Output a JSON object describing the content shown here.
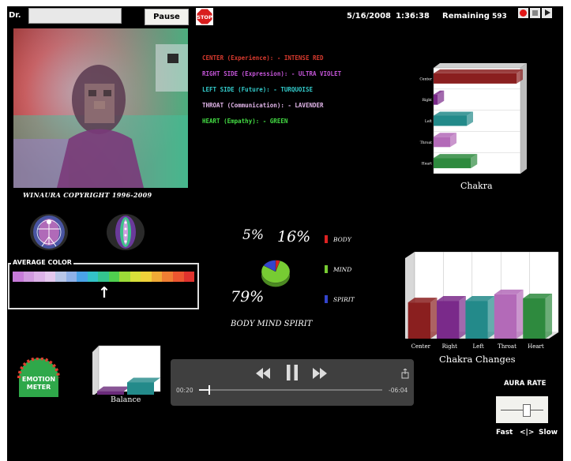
{
  "header": {
    "dr_label": "Dr.",
    "pause_label": "Pause",
    "stop_label": "STOP",
    "date": "5/16/2008",
    "time": "1:36:38",
    "remaining_label": "Remaining",
    "remaining_value": "593"
  },
  "video": {
    "copyright": "WINAURA  COPYRIGHT 1996-2009"
  },
  "chakra_list": [
    {
      "text": "CENTER (Experience):  - INTENSE RED",
      "color": "#d83a2e"
    },
    {
      "text": "RIGHT SIDE (Expression): - ULTRA VIOLET",
      "color": "#c455d8"
    },
    {
      "text": "LEFT SIDE (Future):  - TURQUOISE",
      "color": "#33cccc"
    },
    {
      "text": "THROAT (Communication):  - LAVENDER",
      "color": "#e2b6ea"
    },
    {
      "text": "HEART (Empathy): - GREEN",
      "color": "#44dd44"
    }
  ],
  "average_color": {
    "label": "AVERAGE COLOR",
    "swatches": [
      "#c77bd9",
      "#d19ae0",
      "#dcb2e8",
      "#e4c8ee",
      "#b8c6e8",
      "#8fb1e8",
      "#4aa3e8",
      "#33c2c8",
      "#33c48f",
      "#4fd04f",
      "#9ddc38",
      "#d8e03a",
      "#f0d23a",
      "#f0aa36",
      "#ef7e33",
      "#ec5630",
      "#e0332e"
    ],
    "arrow": "↑"
  },
  "chakra_chart": {
    "title": "Chakra",
    "categories": [
      "Center",
      "Right",
      "Left",
      "Throat",
      "Heart"
    ],
    "values": [
      100,
      5,
      40,
      20,
      45
    ],
    "colors": [
      "#8a1f1f",
      "#7a2a8a",
      "#238a8a",
      "#b36ab8",
      "#2e8a3e"
    ]
  },
  "pie": {
    "title": "BODY MIND SPIRIT",
    "labels": [
      "BODY",
      "MIND",
      "SPIRIT"
    ],
    "values": [
      5,
      79,
      16
    ],
    "pct_labels": [
      "5%",
      "79%",
      "16%"
    ],
    "colors": [
      "#dd2222",
      "#77cc33",
      "#3344cc"
    ]
  },
  "chakra_changes": {
    "title": "Chakra Changes",
    "categories": [
      "Center",
      "Right",
      "Left",
      "Throat",
      "Heart"
    ],
    "values": [
      45,
      47,
      47,
      55,
      50
    ],
    "colors": [
      "#8a1f1f",
      "#7a2a8a",
      "#238a8a",
      "#b36ab8",
      "#2e8a3e"
    ]
  },
  "balance": {
    "label": "Balance",
    "values": [
      20,
      55
    ],
    "colors": [
      "#6a2a7a",
      "#238a8a"
    ]
  },
  "emotion_meter": {
    "label_line1": "EMOTION",
    "label_line2": "METER"
  },
  "player": {
    "time_elapsed": "00:20",
    "time_remaining": "-06:04",
    "progress": 0.05
  },
  "aura_rate": {
    "title": "AURA RATE",
    "fast_label": "Fast",
    "arrows": "<|>",
    "slow_label": "Slow"
  }
}
